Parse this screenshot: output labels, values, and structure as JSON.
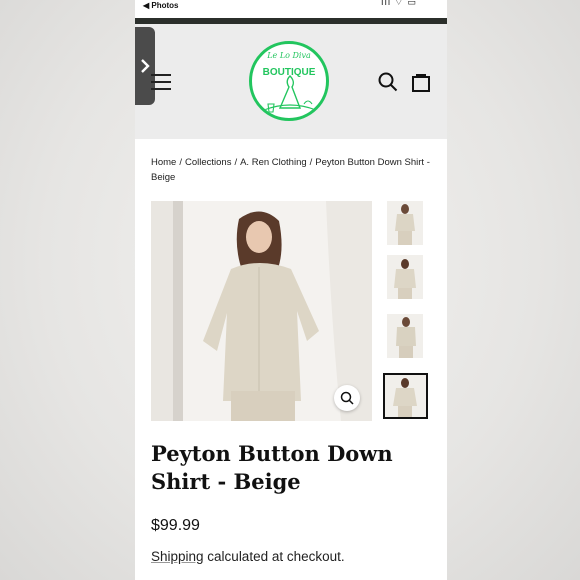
{
  "status_bar": {
    "back_label": "◀ Photos",
    "signal": "ııl ⌔ ▭"
  },
  "store": {
    "logo_script": "Le Lo Diva",
    "logo_name": "BOUTIQUE",
    "brand_color": "#22c55e"
  },
  "breadcrumb": {
    "home": "Home",
    "collections": "Collections",
    "category": "A. Ren Clothing",
    "current": "Peyton Button Down Shirt - Beige",
    "separator": "/"
  },
  "product": {
    "title": "Peyton Button Down Shirt - Beige",
    "price": "$99.99",
    "shipping_link": "Shipping",
    "shipping_rest": " calculated at checkout."
  },
  "thumbnails": [
    "thumb-1",
    "thumb-2",
    "thumb-3",
    "thumb-4"
  ],
  "icons": [
    "chevron-right-icon",
    "menu-icon",
    "search-icon",
    "cart-bag-icon",
    "zoom-icon"
  ]
}
